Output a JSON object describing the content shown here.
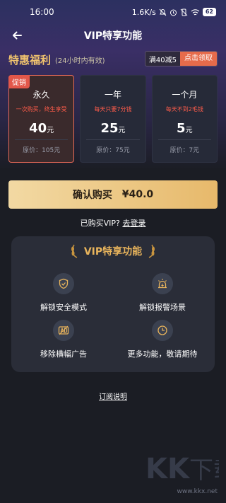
{
  "status_bar": {
    "time": "16:00",
    "net_speed": "1.6K/s",
    "battery": "62"
  },
  "nav": {
    "title": "VIP特享功能"
  },
  "promo": {
    "title": "特惠福利",
    "subtitle": "(24小时内有效)",
    "coupon_text": "满40减5",
    "coupon_button": "点击领取"
  },
  "plans": [
    {
      "badge": "促销",
      "name": "永久",
      "desc": "一次购买，终生享受",
      "price": "40",
      "unit": "元",
      "original": "原价：105元",
      "selected": true
    },
    {
      "name": "一年",
      "desc": "每天只要7分钱",
      "price": "25",
      "unit": "元",
      "original": "原价：75元"
    },
    {
      "name": "一个月",
      "desc": "每天不到2毛钱",
      "price": "5",
      "unit": "元",
      "original": "原价：7元"
    }
  ],
  "buy_button": {
    "label": "确认购买",
    "amount": "¥40.0"
  },
  "login": {
    "text": "已购买VIP?",
    "link": "去登录"
  },
  "features": {
    "title": "VIP特享功能",
    "items": [
      {
        "label": "解锁安全模式",
        "icon": "shield-check-icon"
      },
      {
        "label": "解锁报警场景",
        "icon": "alarm-siren-icon"
      },
      {
        "label": "移除横幅广告",
        "icon": "ad-remove-icon"
      },
      {
        "label": "更多功能，敬请期待",
        "icon": "clock-icon"
      }
    ]
  },
  "subscription_link": "订阅说明",
  "watermark": {
    "text": "KK下载",
    "url": "www.kkx.net"
  },
  "colors": {
    "accent_gold": "#e8b45c",
    "promo_red": "#e2574a",
    "button_gold": "#e7b96b"
  }
}
